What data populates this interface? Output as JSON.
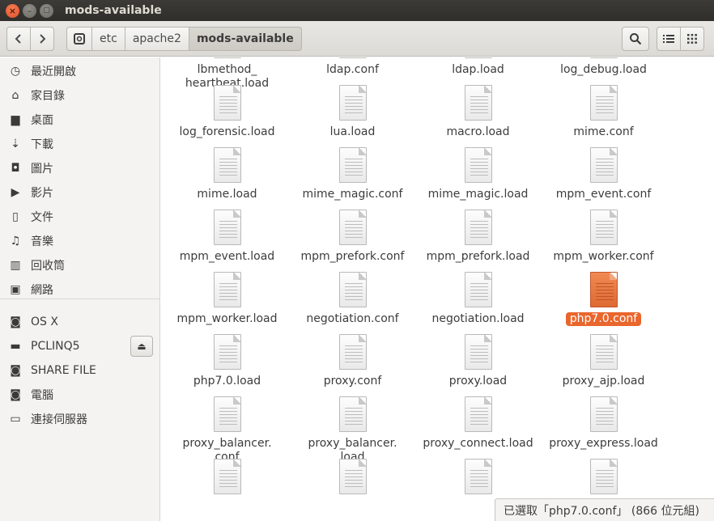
{
  "window": {
    "title": "mods-available"
  },
  "breadcrumb": {
    "root_icon": "drive-icon",
    "items": [
      "etc",
      "apache2",
      "mods-available"
    ]
  },
  "sidebar": {
    "places": [
      {
        "label": "最近開啟",
        "icon": "clock-icon"
      },
      {
        "label": "家目錄",
        "icon": "home-icon"
      },
      {
        "label": "桌面",
        "icon": "folder-icon"
      },
      {
        "label": "下載",
        "icon": "download-icon"
      },
      {
        "label": "圖片",
        "icon": "camera-icon"
      },
      {
        "label": "影片",
        "icon": "video-icon"
      },
      {
        "label": "文件",
        "icon": "document-icon"
      },
      {
        "label": "音樂",
        "icon": "music-icon"
      },
      {
        "label": "回收筒",
        "icon": "trash-icon"
      },
      {
        "label": "網路",
        "icon": "network-icon"
      }
    ],
    "devices": [
      {
        "label": "OS X",
        "icon": "drive-icon"
      },
      {
        "label": "PCLINQ5",
        "icon": "disk-icon"
      },
      {
        "label": "SHARE FILE",
        "icon": "drive-icon"
      },
      {
        "label": "電腦",
        "icon": "drive-icon"
      },
      {
        "label": "連接伺服器",
        "icon": "server-icon"
      }
    ]
  },
  "files": [
    "lbmethod_\nheartbeat.load",
    "ldap.conf",
    "ldap.load",
    "log_debug.load",
    "log_forensic.load",
    "lua.load",
    "macro.load",
    "mime.conf",
    "mime.load",
    "mime_magic.conf",
    "mime_magic.load",
    "mpm_event.conf",
    "mpm_event.load",
    "mpm_prefork.conf",
    "mpm_prefork.load",
    "mpm_worker.conf",
    "mpm_worker.load",
    "negotiation.conf",
    "negotiation.load",
    "php7.0.conf",
    "php7.0.load",
    "proxy.conf",
    "proxy.load",
    "proxy_ajp.load",
    "proxy_balancer.\nconf",
    "proxy_balancer.\nload",
    "proxy_connect.load",
    "proxy_express.load"
  ],
  "selected_file": "php7.0.conf",
  "status": {
    "text": "已選取「php7.0.conf」 (866 位元組)"
  },
  "colors": {
    "accent": "#e9662c",
    "highlight_box": "#d32027",
    "titlebar": "#3c3b37"
  }
}
